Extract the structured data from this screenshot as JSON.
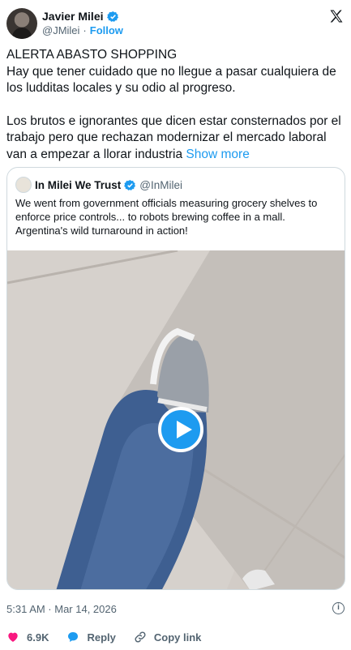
{
  "tweet": {
    "author_name": "Javier Milei",
    "author_handle": "@JMilei",
    "separator": "·",
    "follow_label": "Follow",
    "text_p1": "ALERTA ABASTO SHOPPING\nHay que tener cuidado que no llegue a pasar cualquiera de los ludditas locales y su odio al progreso.",
    "text_p2": "Los brutos e ignorantes que dicen estar consternados por el trabajo pero que rechazan modernizar el mercado laboral van a empezar a llorar industria",
    "show_more_label": "Show more",
    "timestamp": "5:31 AM · Mar 14, 2026",
    "info_icon_glyph": "i"
  },
  "quote": {
    "author_name": "In Milei We Trust",
    "author_handle": "@InMilei",
    "text": "We went from government officials measuring grocery shelves to enforce price controls... to robots brewing coffee in a mall.\nArgentina's wild turnaround in action!"
  },
  "actions": {
    "likes_count": "6.9K",
    "reply_label": "Reply",
    "copy_link_label": "Copy link"
  },
  "colors": {
    "accent": "#1d9bf0",
    "like": "#f91880",
    "secondary_text": "#536471"
  },
  "icons": [
    "verified-badge-icon",
    "x-logo-icon",
    "play-icon",
    "info-icon",
    "heart-icon",
    "reply-icon",
    "link-icon"
  ]
}
